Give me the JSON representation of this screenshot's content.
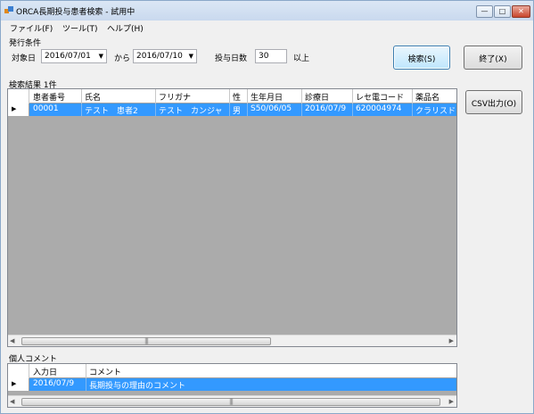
{
  "window": {
    "title": "ORCA長期投与患者検索 - 試用中",
    "min_glyph": "—",
    "max_glyph": "□",
    "close_glyph": "✕"
  },
  "menu": [
    "ファイル(F)",
    "ツール(T)",
    "ヘルプ(H)"
  ],
  "conditions": {
    "group_label": "発行条件",
    "date_label": "対象日",
    "date_from": "2016/07/01",
    "from_label": "から",
    "date_to": "2016/07/10",
    "days_label": "投与日数",
    "days_value": "30",
    "days_suffix": "以上"
  },
  "buttons": {
    "search": "検索(S)",
    "exit": "終了(X)",
    "csv": "CSV出力(O)"
  },
  "results": {
    "label": "検索結果 1件",
    "columns": [
      "患者番号",
      "氏名",
      "フリガナ",
      "性",
      "生年月日",
      "診療日",
      "レセ電コード",
      "薬品名"
    ],
    "rows": [
      [
        "00001",
        "テスト　患者2",
        "テスト　カンジャ",
        "男",
        "S50/06/05",
        "2016/07/9",
        "620004974",
        "クラリスドライ"
      ]
    ]
  },
  "comments": {
    "label": "個人コメント",
    "columns": [
      "入力日",
      "コメント"
    ],
    "rows": [
      [
        "2016/07/9",
        "長期投与の理由のコメント"
      ]
    ]
  },
  "icons": {
    "row_pointer": "▶",
    "arrow_left": "◀",
    "arrow_right": "▶",
    "dropdown": "▼",
    "grip": "|||"
  },
  "colors": {
    "selection": "#3399ff",
    "grid_background": "#ababab",
    "window_background": "#f0f0f0"
  }
}
